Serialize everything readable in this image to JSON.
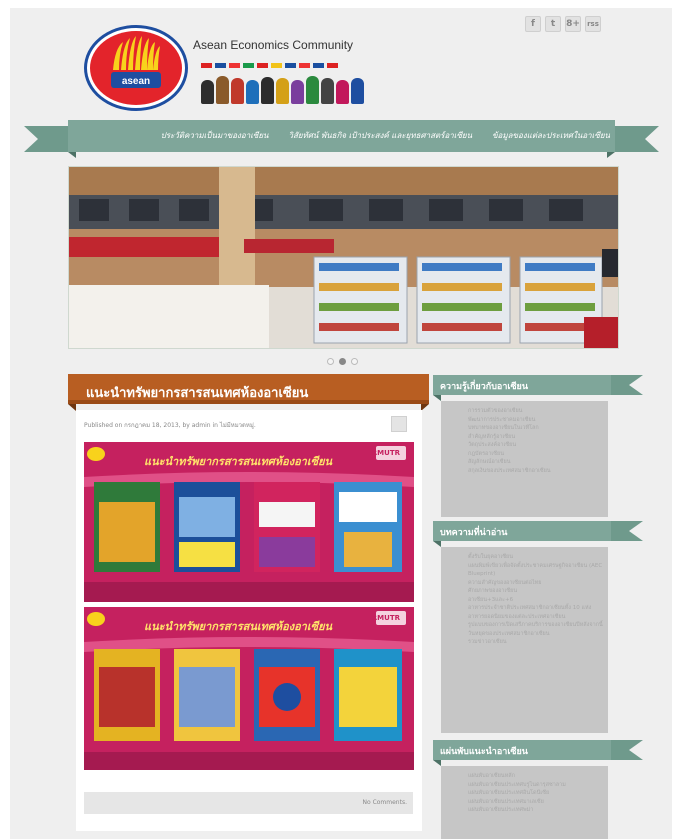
{
  "site": {
    "title": "Asean Economics Community",
    "logo_text": "asean"
  },
  "social": [
    "f",
    "t",
    "8+",
    "rss"
  ],
  "nav": {
    "items": [
      "ประวัติความเป็นมาของอาเซียน",
      "วิสัยทัศน์ พันธกิจ เป้าประสงค์ และยุทธศาสตร์อาเซียน",
      "ข้อมูลของแต่ละประเทศในอาเซียน"
    ]
  },
  "slider": {
    "dots": 3,
    "active_dot": 2
  },
  "post": {
    "title": "แนะนำทรัพยากรสารสนเทศห้องอาเซียน",
    "meta": "Published on กรกฎาคม 18, 2013, by admin in ไม่มีหมวดหมู่.",
    "banner1_title": "แนะนำทรัพยากรสารสนเทศห้องอาเซียน",
    "banner2_title": "แนะนำทรัพยากรสารสนเทศห้องอาเซียน",
    "banner_label": "RMUTR",
    "comments": "No Comments."
  },
  "sidebar": {
    "widgets": [
      {
        "title": "ความรู้เกี่ยวกับอาเซียน",
        "items": [
          "การรวมตัวของอาเซียน",
          "พัฒนาการประชาคมอาเซียน",
          "บทบาทของอาเซียนในเวทีโลก",
          "สำคัญหลักรู้อาเซียน",
          "วัตถุประสงค์อาเซียน",
          "กฎบัตรอาเซียน",
          "สัญลักษณ์อาเซียน",
          "สกุลเงินของประเทศสมาชิกอาเซียน"
        ]
      },
      {
        "title": "บทความที่น่าอ่าน",
        "items": [
          "ตั้งรับในยุคอาเซียน",
          "แผนพิมพ์เขียวเพื่อจัดตั้งประชาคมเศรษฐกิจอาเซียน (AEC Blueprint)",
          "ความสำคัญของอาเซียนต่อไทย",
          "ศักยภาพของอาเซียน",
          "อาเซียน+3และ+6",
          "อาหารประจำชาติประเทศสมาชิกอาเซียนทั้ง 10 แห่ง",
          "อาหารยอดนิยมของแต่ละประเทศอาเซียน",
          "รูปแบบของการเปิดเสรีภาคบริการของอาเซียนปีหลังจากนี้",
          "วันหยุดของประเทศสมาชิกอาเซียน",
          "รวมข่าวอาเซียน"
        ]
      },
      {
        "title": "แผ่นพับแนะนำอาเซียน",
        "items": [
          "แผ่นพับอาเซียนหลัก",
          "แผ่นพับอาเซียนประเทศบรูไนดารุสซาลาม",
          "แผ่นพับอาเซียนประเทศอินโดนีเซีย",
          "แผ่นพับอาเซียนประเทศมาเลเซีย",
          "แผ่นพับอาเซียนประเทศพม่า"
        ]
      }
    ]
  },
  "colors": {
    "ribbon": "#7fa69a",
    "ribbon_dark": "#5f877b",
    "post_header": "#b85e22",
    "banner": "#c5215f"
  }
}
